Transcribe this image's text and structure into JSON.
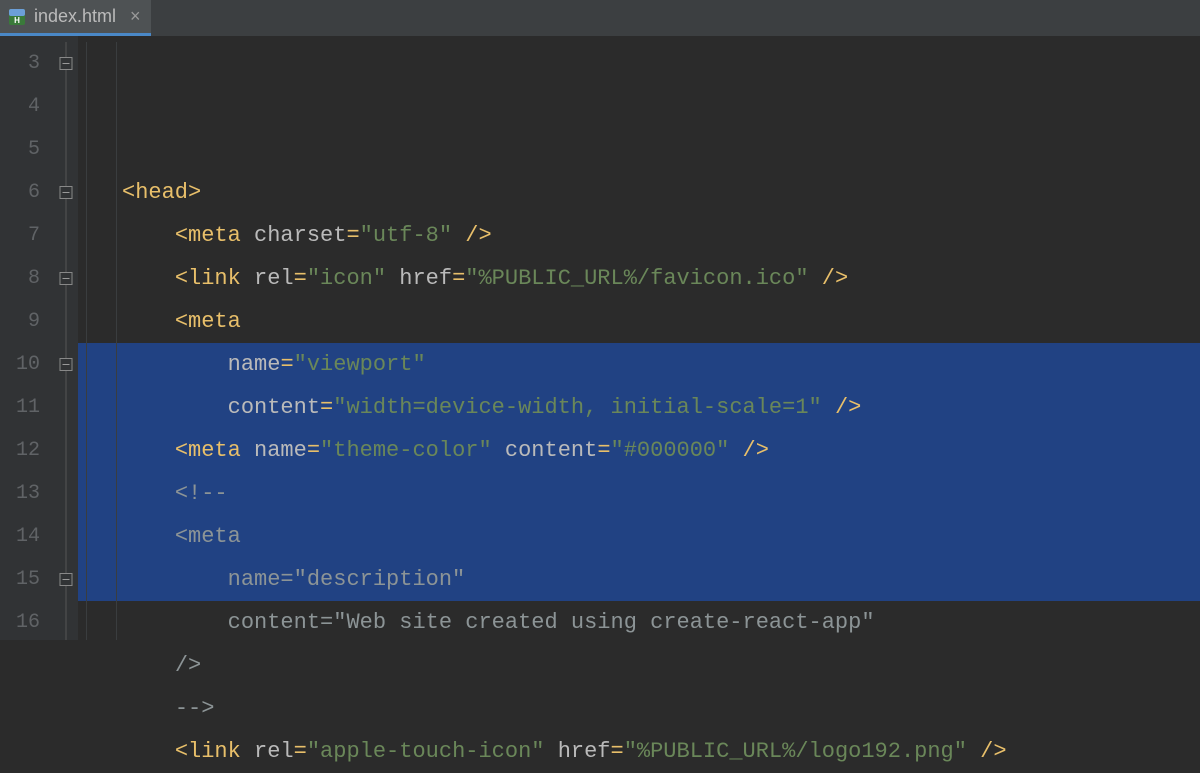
{
  "tab": {
    "filename": "index.html",
    "close_glyph": "×"
  },
  "gutter": {
    "start": 3,
    "end": 16
  },
  "code": {
    "lines": [
      {
        "n": 3,
        "html": [
          [
            "t-punc",
            "<"
          ],
          [
            "t-tag",
            "head"
          ],
          [
            "t-punc",
            ">"
          ]
        ],
        "indent": 0
      },
      {
        "n": 4,
        "html": [
          [
            "t-punc",
            "<"
          ],
          [
            "t-tag",
            "meta "
          ],
          [
            "t-attr",
            "charset"
          ],
          [
            "t-tag",
            "="
          ],
          [
            "t-str",
            "\"utf-8\""
          ],
          [
            "t-tag",
            " "
          ],
          [
            "t-punc",
            "/>"
          ]
        ],
        "indent": 1
      },
      {
        "n": 5,
        "html": [
          [
            "t-punc",
            "<"
          ],
          [
            "t-tag",
            "link "
          ],
          [
            "t-attr",
            "rel"
          ],
          [
            "t-tag",
            "="
          ],
          [
            "t-str",
            "\"icon\""
          ],
          [
            "t-tag",
            " "
          ],
          [
            "t-attr",
            "href"
          ],
          [
            "t-tag",
            "="
          ],
          [
            "t-str",
            "\"%PUBLIC_URL%/favicon.ico\""
          ],
          [
            "t-tag",
            " "
          ],
          [
            "t-punc",
            "/>"
          ]
        ],
        "indent": 1
      },
      {
        "n": 6,
        "html": [
          [
            "t-punc",
            "<"
          ],
          [
            "t-tag",
            "meta"
          ]
        ],
        "indent": 1
      },
      {
        "n": 7,
        "html": [
          [
            "t-attr",
            "name"
          ],
          [
            "t-tag",
            "="
          ],
          [
            "t-str",
            "\"viewport\""
          ]
        ],
        "indent": 2
      },
      {
        "n": 8,
        "html": [
          [
            "t-attr",
            "content"
          ],
          [
            "t-tag",
            "="
          ],
          [
            "t-str",
            "\"width=device-width, initial-scale=1\""
          ],
          [
            "t-tag",
            " "
          ],
          [
            "t-punc",
            "/>"
          ]
        ],
        "indent": 2
      },
      {
        "n": 9,
        "html": [
          [
            "t-punc",
            "<"
          ],
          [
            "t-tag",
            "meta "
          ],
          [
            "t-attr",
            "name"
          ],
          [
            "t-tag",
            "="
          ],
          [
            "t-str",
            "\"theme-color\""
          ],
          [
            "t-tag",
            " "
          ],
          [
            "t-attr",
            "content"
          ],
          [
            "t-tag",
            "="
          ],
          [
            "t-str",
            "\"#000000\""
          ],
          [
            "t-tag",
            " "
          ],
          [
            "t-punc",
            "/>"
          ]
        ],
        "indent": 1
      },
      {
        "n": 10,
        "html": [
          [
            "t-cmt-sel",
            "<!--"
          ]
        ],
        "indent": 1,
        "selected": true
      },
      {
        "n": 11,
        "html": [
          [
            "t-cmt-sel",
            "<meta"
          ]
        ],
        "indent": 1,
        "selected": true
      },
      {
        "n": 12,
        "html": [
          [
            "t-cmt-sel",
            "name=\"description\""
          ]
        ],
        "indent": 2,
        "selected": true
      },
      {
        "n": 13,
        "html": [
          [
            "t-cmt-sel",
            "content=\"Web site created using create-react-app\""
          ]
        ],
        "indent": 2,
        "selected": true
      },
      {
        "n": 14,
        "html": [
          [
            "t-cmt-sel",
            "/>"
          ]
        ],
        "indent": 1,
        "selected": true
      },
      {
        "n": 15,
        "html": [
          [
            "t-cmt-sel",
            "-->"
          ]
        ],
        "indent": 1,
        "selected": true
      },
      {
        "n": 16,
        "html": [
          [
            "t-punc",
            "<"
          ],
          [
            "t-tag",
            "link "
          ],
          [
            "t-attr",
            "rel"
          ],
          [
            "t-tag",
            "="
          ],
          [
            "t-str",
            "\"apple-touch-icon\""
          ],
          [
            "t-tag",
            " "
          ],
          [
            "t-attr",
            "href"
          ],
          [
            "t-tag",
            "="
          ],
          [
            "t-str",
            "\"%PUBLIC_URL%/logo192.png\""
          ],
          [
            "t-tag",
            " "
          ],
          [
            "t-punc",
            "/>"
          ]
        ],
        "indent": 1
      }
    ]
  },
  "fold_marks_at": [
    3,
    6,
    8,
    10,
    15
  ],
  "colors": {
    "bg": "#2b2b2b",
    "gutter": "#313335",
    "selection": "#214283",
    "tag": "#e8bf6a",
    "string": "#6a8759",
    "attr": "#bababa",
    "comment": "#808080"
  }
}
